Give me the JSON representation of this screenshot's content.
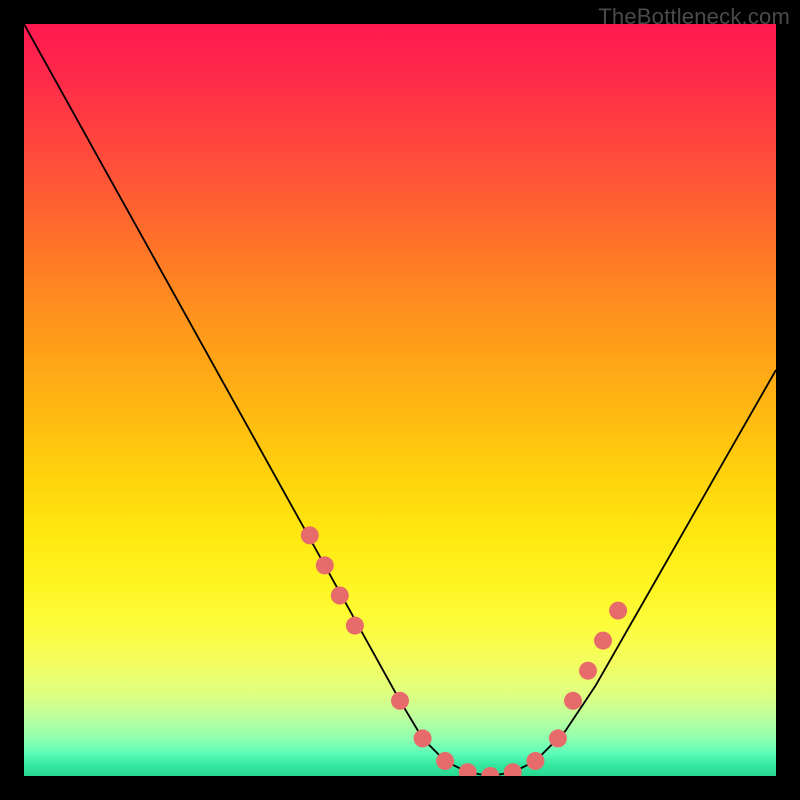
{
  "watermark": "TheBottleneck.com",
  "chart_data": {
    "type": "line",
    "title": "",
    "xlabel": "",
    "ylabel": "",
    "xlim": [
      0,
      100
    ],
    "ylim": [
      0,
      100
    ],
    "series": [
      {
        "name": "bottleneck-curve",
        "x": [
          0,
          5,
          10,
          15,
          20,
          25,
          30,
          35,
          40,
          45,
          50,
          53,
          56,
          59,
          62,
          65,
          68,
          72,
          76,
          80,
          84,
          88,
          92,
          96,
          100
        ],
        "values": [
          100,
          91,
          82,
          73,
          64,
          55,
          46,
          37,
          28,
          19,
          10,
          5,
          2,
          0.5,
          0,
          0.5,
          2,
          6,
          12,
          19,
          26,
          33,
          40,
          47,
          54
        ]
      }
    ],
    "markers": {
      "name": "highlight-dots",
      "x": [
        38,
        40,
        42,
        44,
        50,
        53,
        56,
        59,
        62,
        65,
        68,
        71,
        73,
        75,
        77,
        79
      ],
      "values": [
        32,
        28,
        24,
        20,
        10,
        5,
        2,
        0.5,
        0,
        0.5,
        2,
        5,
        10,
        14,
        18,
        22
      ]
    },
    "gradient_stops": [
      {
        "pos": 0,
        "color": "#ff1850"
      },
      {
        "pos": 0.5,
        "color": "#ffd000"
      },
      {
        "pos": 0.95,
        "color": "#80ffa0"
      },
      {
        "pos": 1.0,
        "color": "#28d890"
      }
    ],
    "marker_color": "#e86b6b",
    "line_color": "#000000"
  }
}
